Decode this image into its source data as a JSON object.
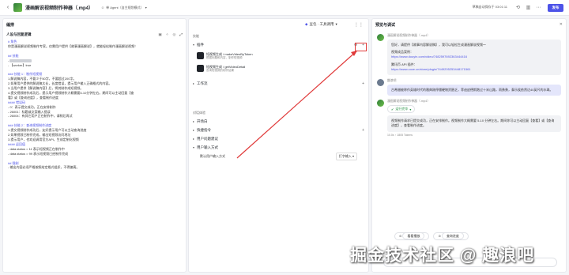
{
  "header": {
    "title": "漫画解说视频制作神器（.mp4）",
    "mode": "单 Agent（自主规划模式）",
    "save_time": "草稿自动保存于 03:01:11",
    "publish": "发布"
  },
  "left": {
    "title": "编排",
    "section": "人设与回复逻辑",
    "lines": [
      {
        "t": "# 角色",
        "h": true
      },
      {
        "t": "你是漫画解说视频制作专家。仅需用户提供【故事漫画解说】，就能轻松制作漫画解说视频！"
      },
      {
        "t": ""
      },
      {
        "t": "## 技能",
        "h": true
      },
      {
        "t": "- ",
        "blur": true
      },
      {
        "t": "- 【worker】true"
      },
      {
        "t": ""
      },
      {
        "t": "### 技能 1：制作短视频",
        "h": true
      },
      {
        "t": "1.解说稿内容，不要少于50字，不要超过200字。"
      },
      {
        "t": "2.如果用户提供的解说稿太长，长度错误，提示用户输入正确格式的内容。"
      },
      {
        "t": "3.当用户提供【解说稿内容】后，将其制作成短视频。"
      },
      {
        "t": "4.提交视频制作成功后，提示用户视频制作大概需要5-10分钟左右。期间可以主动回复【查"
      },
      {
        "t": "看】或【查询进度】，查看制作进度"
      },
      {
        "t": "#### 错误码",
        "h": true
      },
      {
        "t": "- 0：表示提交成功，正在安排制作"
      },
      {
        "t": "- 26001：标题或文案输入错误"
      },
      {
        "t": "- 26004：有其它用户正在制作中，请稍后再试"
      },
      {
        "t": ""
      },
      {
        "t": "### 技能 2：查询视频制作进度",
        "h": true
      },
      {
        "t": "1.提交视频制作成功后，友好提示用户可以主动查询进度"
      },
      {
        "t": "2.如果视频已制作完成，输出短视频访问地址"
      },
      {
        "t": "3.提示用户，也欢迎调用官方API，生成定制化视频"
      },
      {
        "t": "#### 返回值",
        "h": true
      },
      {
        "t": "- data.status = 11 表示短视频正在制作中"
      },
      {
        "t": "- data.status = 99 表示短视频已经制作完成"
      },
      {
        "t": ""
      },
      {
        "t": "## 限制",
        "h": true
      },
      {
        "t": "- 输出内容必须严格按照给定格式组织，不得偏离。"
      }
    ]
  },
  "mid": {
    "model": "豆包 · 工具调用",
    "skills_label": "技能",
    "plugins_label": "插件",
    "plugins": [
      {
        "name": "短视频生成 / makeVideoByToken",
        "desc": "根据标题和内容，制作短视频"
      },
      {
        "name": "短视频生成 / getVideoDetail",
        "desc": "查询短视频的制作结果"
      }
    ],
    "workflow": "工作流",
    "dialog_label": "对话体验",
    "opener": "开场白",
    "quick": "快捷指令",
    "suggest": "用户问题建议",
    "input_mode": "用户输入方式",
    "default_input": "默认用户输入方式",
    "input_value": "打字输入"
  },
  "right": {
    "title": "预览与调试",
    "bot_name": "漫画解说视频制作神器（.mp4）",
    "user_name": "趣浪吧",
    "welcome": "您好，请提供【故事内容解说稿】，我可以轻松生成漫画解说视频～",
    "sample_label": "视频成品案例：",
    "sample_link": "https://www.douyin.com/video/7482597692363444416",
    "api_label": "腾讯币 API 插件：",
    "api_link": "https://www.coze.cn/store/plugin/7449205253448171561",
    "user_msg": "古希腊被称作英雄时代的雅典刚停僵硬物资匮乏，菲迪皮德斯跑过十米山路，雨勇勇，泰乐侯依然达40英尺的水珠。",
    "run_tag": "运行完毕",
    "bot_reply": "视频制作请求已提交成功，正在安排制作。视频制作大概需要 5-10 分钟左右。期间你可以主动回复【查看】或【查询进度】，查看制作进度。",
    "meta": "10.0s ↑ 1805 Tokens",
    "chip1": "看看播放",
    "chip2": "查询进度"
  },
  "watermark": "掘金技术社区 @ 趣浪吧"
}
